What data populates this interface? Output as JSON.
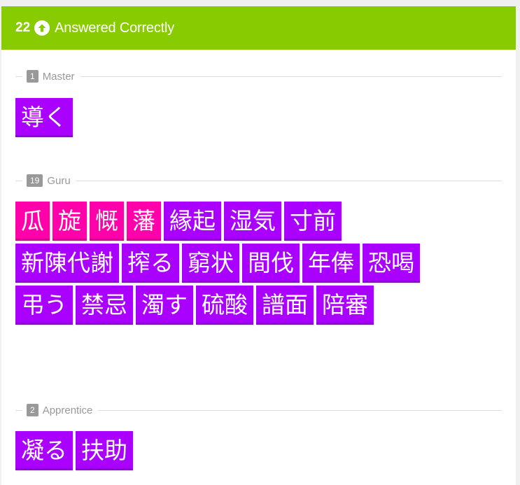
{
  "colors": {
    "header_bg": "#88cc00",
    "kanji": "#ff00aa",
    "vocabulary": "#aa00ff",
    "badge": "#999999"
  },
  "header": {
    "count": "22",
    "icon": "arrow-up-circle-icon",
    "label": "Answered Correctly"
  },
  "sections": [
    {
      "count": "1",
      "label": "Master",
      "items": [
        {
          "text": "導く",
          "type": "vocabulary"
        }
      ]
    },
    {
      "count": "19",
      "label": "Guru",
      "items": [
        {
          "text": "瓜",
          "type": "kanji"
        },
        {
          "text": "旋",
          "type": "kanji"
        },
        {
          "text": "慨",
          "type": "kanji"
        },
        {
          "text": "藩",
          "type": "kanji"
        },
        {
          "text": "縁起",
          "type": "vocabulary"
        },
        {
          "text": "湿気",
          "type": "vocabulary"
        },
        {
          "text": "寸前",
          "type": "vocabulary"
        },
        {
          "text": "新陳代謝",
          "type": "vocabulary"
        },
        {
          "text": "搾る",
          "type": "vocabulary"
        },
        {
          "text": "窮状",
          "type": "vocabulary"
        },
        {
          "text": "間伐",
          "type": "vocabulary"
        },
        {
          "text": "年俸",
          "type": "vocabulary"
        },
        {
          "text": "恐喝",
          "type": "vocabulary"
        },
        {
          "text": "弔う",
          "type": "vocabulary"
        },
        {
          "text": "禁忌",
          "type": "vocabulary"
        },
        {
          "text": "濁す",
          "type": "vocabulary"
        },
        {
          "text": "硫酸",
          "type": "vocabulary"
        },
        {
          "text": "譜面",
          "type": "vocabulary"
        },
        {
          "text": "陪審",
          "type": "vocabulary"
        }
      ]
    },
    {
      "count": "2",
      "label": "Apprentice",
      "items": [
        {
          "text": "凝る",
          "type": "vocabulary"
        },
        {
          "text": "扶助",
          "type": "vocabulary"
        }
      ]
    }
  ]
}
